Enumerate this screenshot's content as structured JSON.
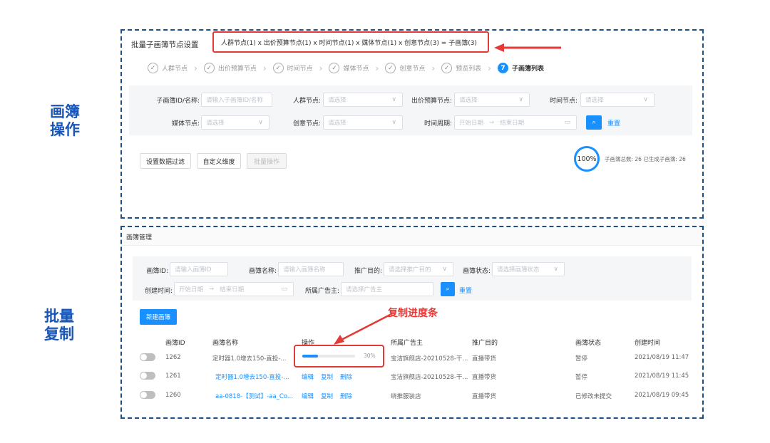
{
  "side_labels": {
    "top": "画簿\n操作",
    "bottom": "批量\n复制"
  },
  "batch": {
    "title": "批量子画簿节点设置",
    "formula": "人群节点(1) x 出价预算节点(1) x 时间节点(1) x 媒体节点(1) x 创意节点(3) = 子画簿(3)",
    "steps": [
      {
        "label": "人群节点",
        "icon": "check-circle-icon"
      },
      {
        "label": "出价预算节点",
        "icon": "check-circle-icon"
      },
      {
        "label": "时间节点",
        "icon": "check-circle-icon"
      },
      {
        "label": "媒体节点",
        "icon": "check-circle-icon"
      },
      {
        "label": "创意节点",
        "icon": "check-circle-icon"
      },
      {
        "label": "预览列表",
        "icon": "check-circle-icon"
      },
      {
        "label": "子画簿列表",
        "number": "7",
        "active": true
      }
    ],
    "filters": {
      "id_label": "子画簿ID/名称:",
      "id_placeholder": "请输入子画簿ID/名称",
      "crowd_label": "人群节点:",
      "crowd_placeholder": "请选择",
      "bid_label": "出价预算节点:",
      "bid_placeholder": "请选择",
      "time_label": "时间节点:",
      "time_placeholder": "请选择",
      "media_label": "媒体节点:",
      "media_placeholder": "请选择",
      "creative_label": "创意节点:",
      "creative_placeholder": "请选择",
      "period_label": "时间周期:",
      "start_placeholder": "开始日期",
      "end_placeholder": "结束日期",
      "reset": "重置"
    },
    "actions": {
      "data_filter": "设置数据过滤",
      "custom_dim": "自定义维度",
      "batch_op": "批量操作"
    },
    "progress": {
      "percent_text": "100%",
      "percent": 100,
      "stats": "子画簿总数: 26  已生成子画簿: 26"
    }
  },
  "manage": {
    "title": "画簿管理",
    "filters": {
      "id_label": "画簿ID:",
      "id_placeholder": "请输入画簿ID",
      "name_label": "画簿名称:",
      "name_placeholder": "请输入画簿名称",
      "goal_label": "推广目的:",
      "goal_placeholder": "请选择推广目的",
      "status_label": "画簿状态:",
      "status_placeholder": "请选择画簿状态",
      "created_label": "创建时间:",
      "start_placeholder": "开始日期",
      "end_placeholder": "结束日期",
      "adv_label": "所属广告主:",
      "adv_placeholder": "请选择广告主",
      "reset": "重置"
    },
    "new_button": "新建画簿",
    "callout": "复制进度条",
    "columns": [
      "画簿ID",
      "画簿名称",
      "操作",
      "所属广告主",
      "推广目的",
      "画簿状态",
      "创建时间"
    ],
    "rows": [
      {
        "id": "1262",
        "name": "定时器1.0增去150-直投-...",
        "advertiser": "宝洁旗舰店-20210528-干...",
        "goal": "直播带货",
        "status": "暂停",
        "created": "2021/08/19 11:47",
        "progress_percent": 30,
        "progress_text": "30%"
      },
      {
        "id": "1261",
        "name": "定时器1.0增去150-直投-...",
        "ops": [
          "编辑",
          "复制",
          "删除"
        ],
        "advertiser": "宝洁旗舰店-20210528-干...",
        "goal": "直播带货",
        "status": "暂停",
        "created": "2021/08/19 11:45"
      },
      {
        "id": "1260",
        "name": "aa-0818-【测试】-aa_Co...",
        "ops": [
          "编辑",
          "复制",
          "删除"
        ],
        "advertiser": "绕推服装店",
        "goal": "直播带货",
        "status": "已修改未提交",
        "created": "2021/08/19 09:45"
      }
    ]
  },
  "colors": {
    "accent": "#1890ff",
    "highlight": "#e53935",
    "dash": "#1b4f8a",
    "side_label": "#1a56b8"
  }
}
